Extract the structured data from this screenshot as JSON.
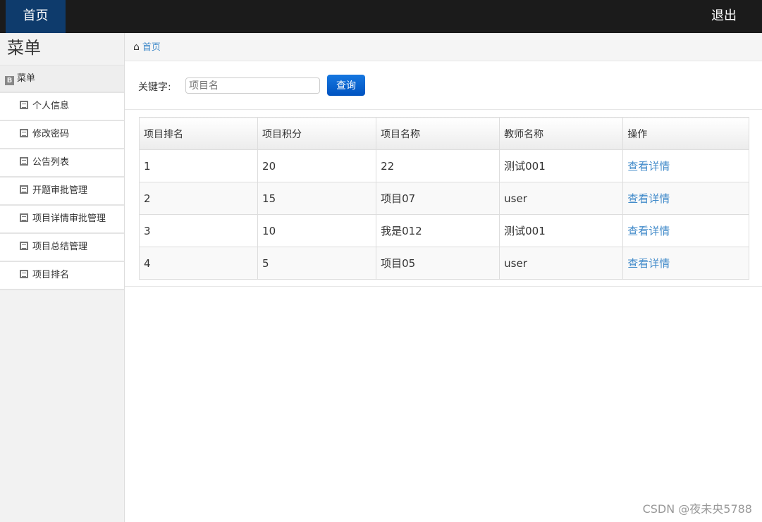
{
  "topbar": {
    "brand": "首页",
    "logout": "退出"
  },
  "sidebar": {
    "title": "菜单",
    "section": "菜单",
    "items": [
      "个人信息",
      "修改密码",
      "公告列表",
      "开题审批管理",
      "项目详情审批管理",
      "项目总结管理",
      "项目排名"
    ]
  },
  "breadcrumb": {
    "home": "首页"
  },
  "search": {
    "label": "关键字:",
    "placeholder": "项目名",
    "button": "查询"
  },
  "table": {
    "headers": [
      "项目排名",
      "项目积分",
      "项目名称",
      "教师名称",
      "操作"
    ],
    "rows": [
      [
        "1",
        "20",
        "22",
        "测试001",
        "查看详情"
      ],
      [
        "2",
        "15",
        "项目07",
        "user",
        "查看详情"
      ],
      [
        "3",
        "10",
        "我是012",
        "测试001",
        "查看详情"
      ],
      [
        "4",
        "5",
        "项目05",
        "user",
        "查看详情"
      ]
    ]
  },
  "watermark": "CSDN @夜未央5788"
}
